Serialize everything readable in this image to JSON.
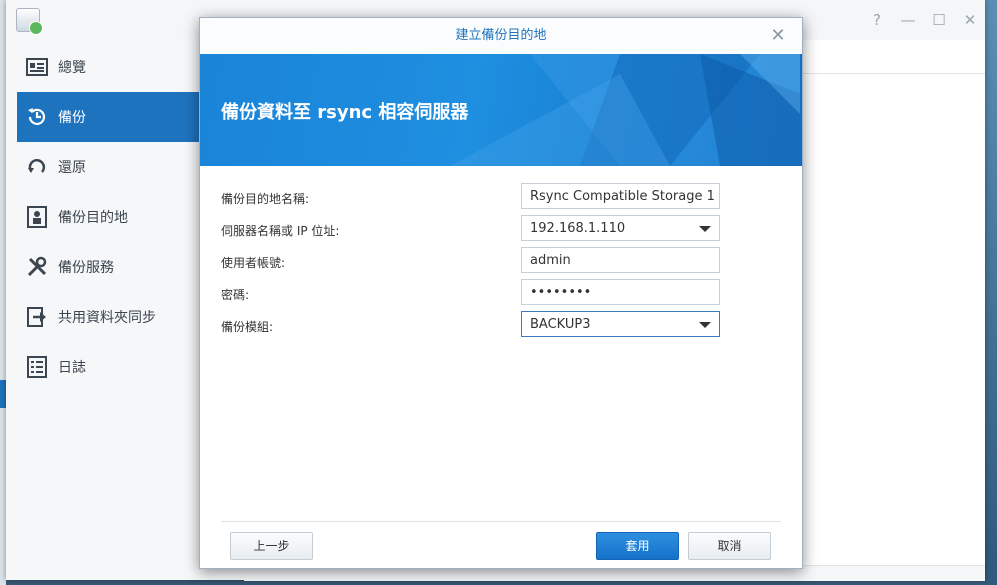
{
  "app": {
    "sidebar": [
      {
        "label": "總覽",
        "icon": "overview-icon"
      },
      {
        "label": "備份",
        "icon": "backup-clock-icon",
        "active": true
      },
      {
        "label": "還原",
        "icon": "restore-icon"
      },
      {
        "label": "備份目的地",
        "icon": "destination-icon"
      },
      {
        "label": "備份服務",
        "icon": "tools-icon"
      },
      {
        "label": "共用資料夾同步",
        "icon": "sync-arrow-icon"
      },
      {
        "label": "日誌",
        "icon": "log-icon"
      }
    ],
    "window_controls": [
      "?",
      "—",
      "☐",
      "✕"
    ]
  },
  "dialog": {
    "title": "建立備份目的地",
    "banner_title": "備份資料至 rsync 相容伺服器",
    "fields": [
      {
        "label": "備份目的地名稱:",
        "value": "Rsync Compatible Storage 1",
        "type": "text"
      },
      {
        "label": "伺服器名稱或 IP 位址:",
        "value": "192.168.1.110",
        "type": "combo"
      },
      {
        "label": "使用者帳號:",
        "value": "admin",
        "type": "text"
      },
      {
        "label": "密碼:",
        "value": "••••••••",
        "type": "password"
      },
      {
        "label": "備份模組:",
        "value": "BACKUP3",
        "type": "combo"
      }
    ],
    "buttons": {
      "back": "上一步",
      "apply": "套用",
      "cancel": "取消"
    },
    "colors": {
      "accent": "#1e73be",
      "banner": "#1a84d8"
    }
  }
}
